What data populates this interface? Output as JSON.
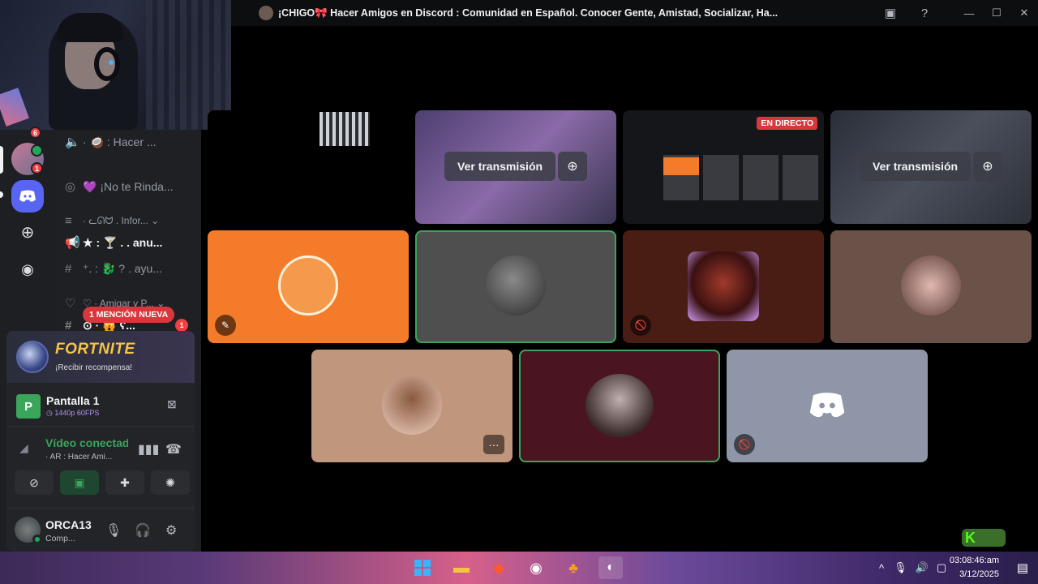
{
  "window": {
    "title": "¡CHIGO🎀 Hacer Amigos en Discord : Comunidad en Español. Conocer Gente, Amistad, Socializar, Ha...",
    "controls": [
      "inbox-icon",
      "help-icon",
      "minimize-icon",
      "maximize-icon",
      "close-icon"
    ]
  },
  "rail": {
    "badges": [
      "6",
      "1"
    ],
    "items": [
      "server-avatar",
      "server-avatar",
      "discord-home",
      "add-server",
      "explore"
    ]
  },
  "channels": {
    "items": [
      {
        "icon": "🔊",
        "label": "· 🥥 : Hacer ..."
      },
      {
        "icon": "◎",
        "label": "💜 ¡No te Rinda..."
      },
      {
        "icon": "≡",
        "label": "· ᓚᘏᗢ . Infor... ⌄"
      },
      {
        "icon": "📢",
        "label": "★ : 🍸 . . anu..."
      },
      {
        "icon": "#",
        "label": "⁺. : 🐉 ? . ayu..."
      },
      {
        "icon": "♡",
        "label": "♡ · Amigar y P... ⌄"
      },
      {
        "icon": "#",
        "label": "⊙ · 🙀 ʕ..."
      }
    ],
    "mention_pill": "1 MENCIÓN NUEVA",
    "mention_count": "1"
  },
  "promo": {
    "title": "FORTNITE",
    "subtitle": "¡Recibir recompensa!"
  },
  "stream": {
    "letter": "P",
    "name": "Pantalla 1",
    "quality": "◷ 1440p 60FPS"
  },
  "voice": {
    "status": "Vídeo conectado",
    "channel": "· AR : Hacer Ami..."
  },
  "user": {
    "name": "ORCA13",
    "status": "Comp..."
  },
  "grid": {
    "ver_label": "Ver transmisión",
    "live_label": "EN DIRECTO",
    "more_label": "···"
  },
  "tile_colors": [
    "#f47b2a",
    "#4f4f4f",
    "#4a1d14",
    "#6b5248",
    "#c0977c",
    "#4a1520",
    "#8e96a7"
  ],
  "kick": "K",
  "clock": {
    "time": "03:08:46:am",
    "date": "3/12/2025"
  }
}
